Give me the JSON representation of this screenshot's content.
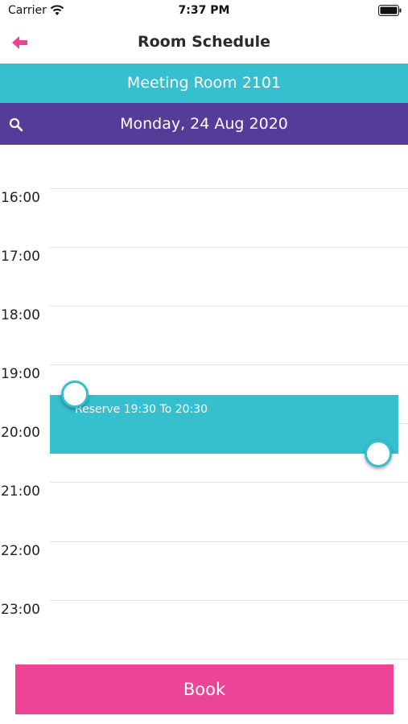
{
  "status_bar": {
    "carrier": "Carrier",
    "time": "7:37 PM",
    "icons": [
      "wifi-icon",
      "battery-icon"
    ]
  },
  "nav": {
    "back_icon": "arrow-left-icon",
    "title": "Room Schedule"
  },
  "room": {
    "name": "Meeting Room 2101"
  },
  "date_bar": {
    "search_icon": "search-icon",
    "date": "Monday, 24 Aug 2020"
  },
  "timeline": {
    "hours": [
      "16:00",
      "17:00",
      "18:00",
      "19:00",
      "20:00",
      "21:00",
      "22:00",
      "23:00"
    ]
  },
  "reservation": {
    "label": "Reserve 19:30 To 20:30",
    "start": "19:30",
    "end": "20:30"
  },
  "book_button": {
    "label": "Book"
  },
  "colors": {
    "accent_teal": "#35bfcf",
    "accent_purple": "#563b98",
    "accent_pink": "#ec4497"
  }
}
